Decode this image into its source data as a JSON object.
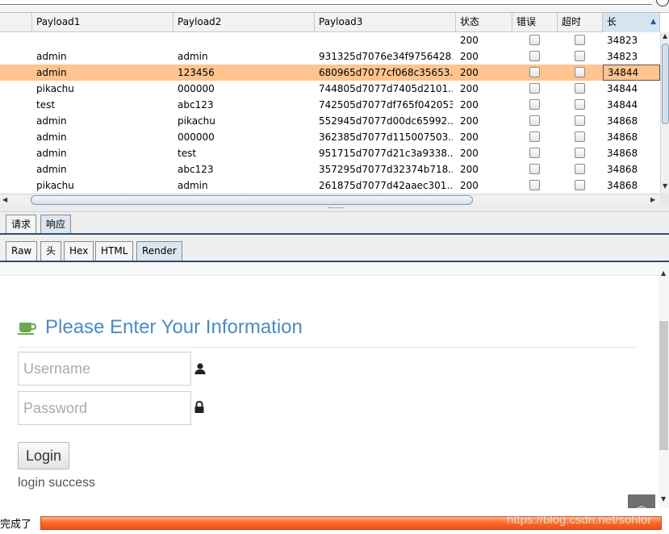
{
  "results_table": {
    "headers": [
      "Payload1",
      "Payload2",
      "Payload3",
      "状态",
      "错误",
      "超时",
      "长"
    ],
    "sort_indicator": "▲",
    "rows": [
      {
        "p1": "",
        "p2": "",
        "p3": "",
        "status": "200",
        "length": "34823"
      },
      {
        "p1": "admin",
        "p2": "admin",
        "p3": "931325d7076e34f9756428...",
        "status": "200",
        "length": "34823"
      },
      {
        "p1": "admin",
        "p2": "123456",
        "p3": "680965d7077cf068c35653...",
        "status": "200",
        "length": "34844"
      },
      {
        "p1": "pikachu",
        "p2": "000000",
        "p3": "744805d7077d7405d2101...",
        "status": "200",
        "length": "34844"
      },
      {
        "p1": "test",
        "p2": "abc123",
        "p3": "742505d7077df765f042053...",
        "status": "200",
        "length": "34844"
      },
      {
        "p1": "admin",
        "p2": "pikachu",
        "p3": "552945d7077d00dc65992...",
        "status": "200",
        "length": "34868"
      },
      {
        "p1": "admin",
        "p2": "000000",
        "p3": "362385d7077d115007503...",
        "status": "200",
        "length": "34868"
      },
      {
        "p1": "admin",
        "p2": "test",
        "p3": "951715d7077d21c3a9338...",
        "status": "200",
        "length": "34868"
      },
      {
        "p1": "admin",
        "p2": "abc123",
        "p3": "357295d7077d32374b718...",
        "status": "200",
        "length": "34868"
      },
      {
        "p1": "pikachu",
        "p2": "admin",
        "p3": "261875d7077d42aaec301...",
        "status": "200",
        "length": "34868"
      }
    ],
    "selected_row": 2,
    "selection_color": "#ffc48f"
  },
  "tabs_top": [
    "请求",
    "响应"
  ],
  "tabs_top_active": "响应",
  "tabs_view": [
    "Raw",
    "头",
    "Hex",
    "HTML",
    "Render"
  ],
  "tabs_view_active": "Render",
  "render": {
    "heading": "Please Enter Your Information",
    "heading_icon": "coffee-cup-icon",
    "heading_color": "#4a8bc1",
    "icon_color": "#6aa84f",
    "username_placeholder": "Username",
    "username_icon": "user-icon",
    "password_placeholder": "Password",
    "password_icon": "lock-icon",
    "login_label": "Login",
    "message": "login success",
    "scroll_top_icon": "double-chevron-up-icon"
  },
  "statusbar": {
    "text": "完成了",
    "progress_fraction": 1.0,
    "watermark": "https://blog.csdn.net/sohlor"
  }
}
